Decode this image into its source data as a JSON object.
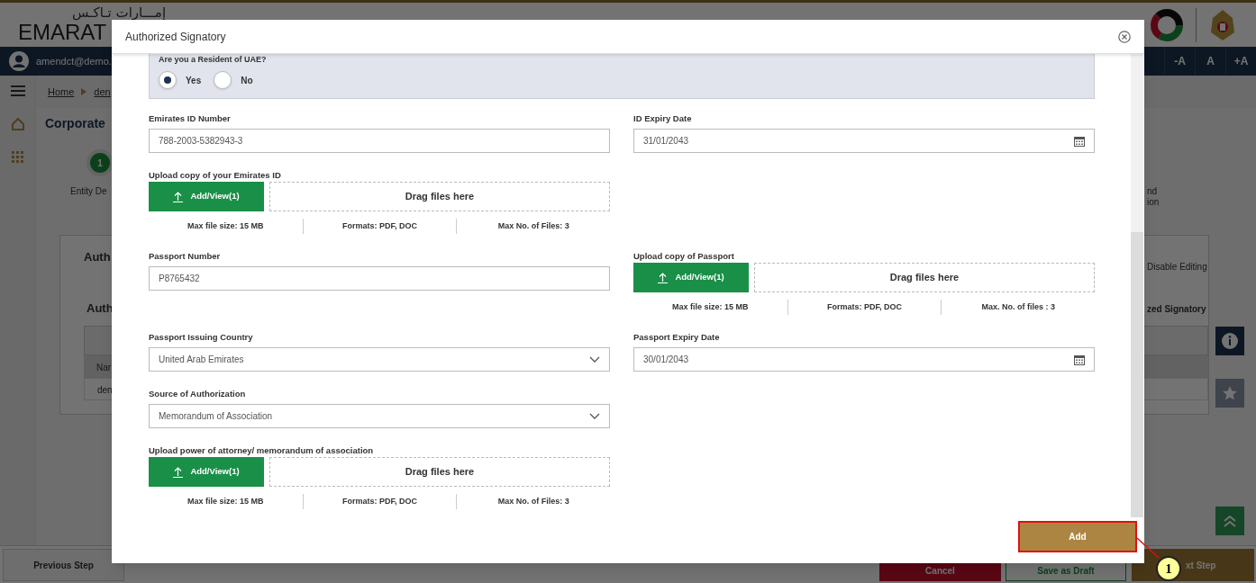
{
  "header": {
    "arabic_logo": "إمـــارات تـاكـس",
    "logo": "EMARAT",
    "user_email": "amendct@demo.",
    "font_buttons": [
      "-A",
      "A",
      "+A"
    ]
  },
  "breadcrumb": [
    {
      "label": "Home"
    },
    {
      "label": "den"
    }
  ],
  "page": {
    "title": "Corporate",
    "step": {
      "number": "1",
      "label": "Entity De"
    },
    "step_right_lines": [
      "nd",
      "ion"
    ],
    "section_title": "Auth",
    "disable_editing": "Disable Editing",
    "subsection_title": "Auth",
    "subsection_title_right": "zed Signatory",
    "table": {
      "header": "Nar",
      "rows": [
        "den"
      ]
    }
  },
  "footer": {
    "previous": "Previous Step",
    "cancel": "Cancel",
    "save_draft": "Save as Draft",
    "next": "xt Step"
  },
  "modal": {
    "title": "Authorized Signatory",
    "resident": {
      "question": "Are you a Resident of UAE?",
      "options": [
        {
          "label": "Yes",
          "selected": true
        },
        {
          "label": "No",
          "selected": false
        }
      ]
    },
    "rows": [
      {
        "left": {
          "kind": "text",
          "label": "Emirates ID Number",
          "value": "788-2003-5382943-3"
        },
        "right": {
          "kind": "date",
          "label": "ID Expiry Date",
          "value": "31/01/2043"
        }
      },
      {
        "left": {
          "kind": "upload",
          "label": "Upload copy of your Emirates ID",
          "button": "Add/View(1)",
          "drop": "Drag files here",
          "info": [
            "Max file size: 15 MB",
            "Formats: PDF, DOC",
            "Max No. of Files: 3"
          ]
        }
      },
      {
        "left": {
          "kind": "text",
          "label": "Passport Number",
          "value": "P8765432"
        },
        "right": {
          "kind": "upload",
          "label": "Upload copy of Passport",
          "button": "Add/View(1)",
          "drop": "Drag files here",
          "info": [
            "Max file size: 15 MB",
            "Formats: PDF, DOC",
            "Max. No. of files : 3"
          ]
        }
      },
      {
        "left": {
          "kind": "select",
          "label": "Passport Issuing Country",
          "value": "United Arab Emirates"
        },
        "right": {
          "kind": "date",
          "label": "Passport Expiry Date",
          "value": "30/01/2043"
        }
      },
      {
        "left": {
          "kind": "select",
          "label": "Source of Authorization",
          "value": "Memorandum of Association"
        }
      },
      {
        "left": {
          "kind": "upload",
          "label": "Upload power of attorney/ memorandum of association",
          "button": "Add/View(1)",
          "drop": "Drag files here",
          "info": [
            "Max file size: 15 MB",
            "Formats: PDF, DOC",
            "Max No. of Files: 3"
          ]
        }
      }
    ],
    "add_button": "Add"
  },
  "callout": {
    "number": "1"
  }
}
